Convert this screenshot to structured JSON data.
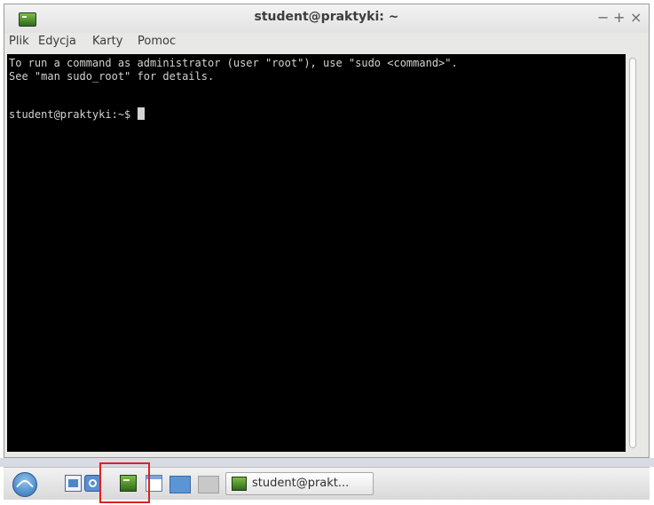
{
  "window": {
    "title": "student@praktyki: ~",
    "controls": {
      "minimize": "−",
      "maximize": "+",
      "close": "×"
    }
  },
  "menubar": {
    "items": [
      {
        "label": "Plik"
      },
      {
        "label": "Edycja"
      },
      {
        "label": "Karty"
      },
      {
        "label": "Pomoc"
      }
    ]
  },
  "terminal": {
    "lines": [
      "To run a command as administrator (user \"root\"), use \"sudo <command>\".",
      "See \"man sudo_root\" for details.",
      "student@praktyki:~$"
    ],
    "background": "#000000",
    "foreground": "#d3d3d3"
  },
  "taskbar": {
    "launchers": [
      {
        "icon": "start-menu-icon"
      },
      {
        "icon": "file-manager-icon"
      },
      {
        "icon": "network-icon"
      },
      {
        "icon": "terminal-icon"
      },
      {
        "icon": "window-icon"
      }
    ],
    "task": {
      "label": "student@prakt..."
    },
    "highlight_color": "#e02020"
  }
}
